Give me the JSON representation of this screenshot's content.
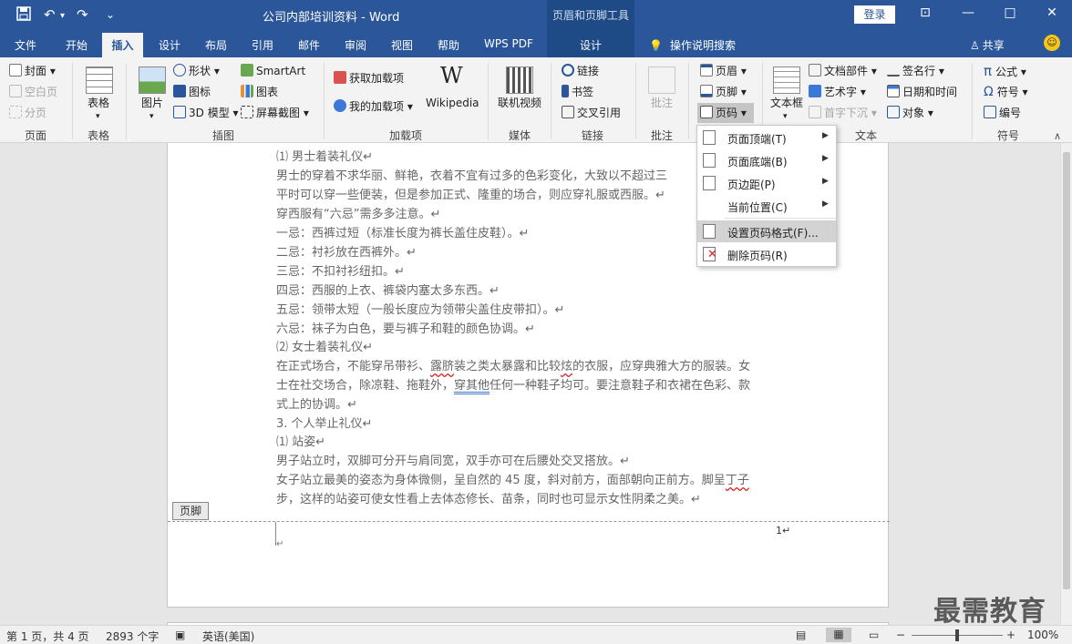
{
  "titlebar": {
    "doc_title": "公司内部培训资料 - Word",
    "context_tools": "页眉和页脚工具",
    "login": "登录",
    "save_icon": "save-icon",
    "undo": "↶",
    "redo": "↷",
    "quick_access_more": "⌄",
    "minimize": "—",
    "restore": "□",
    "close": "✕",
    "ribbon_options": "⊡"
  },
  "tabs": {
    "file": "文件",
    "home": "开始",
    "insert": "插入",
    "design": "设计",
    "layout": "布局",
    "references": "引用",
    "mailings": "邮件",
    "review": "审阅",
    "view": "视图",
    "help": "帮助",
    "wpspdf": "WPS PDF",
    "hf_design": "设计",
    "tellme": "操作说明搜索",
    "share": "共享"
  },
  "ribbon": {
    "pages": {
      "cover": "封面",
      "blank": "空白页",
      "break": "分页",
      "label": "页面"
    },
    "tables": {
      "table": "表格",
      "label": "表格"
    },
    "illustrations": {
      "picture": "图片",
      "shapes": "形状",
      "icons": "图标",
      "model3d": "3D 模型",
      "smartart": "SmartArt",
      "chart": "图表",
      "screenshot": "屏幕截图",
      "label": "插图"
    },
    "addins": {
      "get": "获取加载项",
      "mine": "我的加载项",
      "wikipedia": "Wikipedia",
      "wiki_glyph": "W",
      "label": "加载项"
    },
    "media": {
      "video": "联机视频",
      "label": "媒体"
    },
    "links": {
      "link": "链接",
      "bookmark": "书签",
      "crossref": "交叉引用",
      "label": "链接"
    },
    "comments": {
      "comment": "批注",
      "label": "批注"
    },
    "headerfooter": {
      "header": "页眉",
      "footer": "页脚",
      "pagenum": "页码"
    },
    "text": {
      "textbox": "文本框",
      "quickparts": "文档部件",
      "wordart": "艺术字",
      "dropcap": "首字下沉",
      "signature": "签名行",
      "datetime": "日期和时间",
      "object": "对象",
      "label": "文本"
    },
    "symbols": {
      "equation": "公式",
      "symbol": "符号",
      "number": "编号",
      "label": "符号",
      "pi": "π",
      "omega": "Ω"
    }
  },
  "menu": {
    "items": [
      {
        "label": "页面顶端(T)",
        "submenu": true
      },
      {
        "label": "页面底端(B)",
        "submenu": true
      },
      {
        "label": "页边距(P)",
        "submenu": true
      },
      {
        "label": "当前位置(C)",
        "submenu": true
      },
      {
        "label": "设置页码格式(F)...",
        "submenu": false,
        "highlighted": true
      },
      {
        "label": "删除页码(R)",
        "submenu": false
      }
    ],
    "arrow": "▶"
  },
  "document": {
    "lines": [
      "⑴ 男士着装礼仪↵",
      "男士的穿着不求华丽、鲜艳，衣着不宜有过多的色彩变化，大致以不超过三",
      "平时可以穿一些便装，但是参加正式、隆重的场合，则应穿礼服或西服。↵",
      "穿西服有“六忌”需多多注意。↵",
      "一忌：西裤过短（标准长度为裤长盖住皮鞋）。↵",
      "二忌：衬衫放在西裤外。↵",
      "三忌：不扣衬衫纽扣。↵",
      "四忌：西服的上衣、裤袋内塞太多东西。↵",
      "五忌：领带太短（一般长度应为领带尖盖住皮带扣）。↵",
      "六忌：袜子为白色，要与裤子和鞋的颜色协调。↵",
      "⑵ 女士着装礼仪↵"
    ],
    "para_a": {
      "p1": "在正式场合，不能穿吊带衫、",
      "p2": "露脐",
      "p3": "装之类太暴露和比较",
      "p4": "炫",
      "p5": "的衣服，应穿典雅大方的服装。女"
    },
    "para_b": {
      "p1": "士在社交场合，除凉鞋、拖鞋外，",
      "p2": "穿其他",
      "p3": "任何一种鞋子均可。要注意鞋子和衣裙在色彩、款"
    },
    "lines2": [
      "式上的协调。↵",
      "3. 个人举止礼仪↵",
      "⑴ 站姿↵",
      "男子站立时，双脚可分开与肩同宽，双手亦可在后腰处交叉搭放。↵"
    ],
    "para_c": {
      "p1": "女子站立最美的姿态为身体微侧，呈自然的 45 度，斜对前方，面部朝向正前方。脚呈",
      "p2": "丁子"
    },
    "last_line": "步，这样的站姿可使女性看上去体态修长、苗条，同时也可显示女性阴柔之美。↵",
    "footer_tag": "页脚",
    "page_number": "1↵",
    "footer_mark": "↵"
  },
  "status": {
    "page": "第 1 页，共 4 页",
    "words": "2893 个字",
    "language": "英语(美国)",
    "zoom_minus": "−",
    "zoom_plus": "+",
    "zoom": "100%"
  },
  "watermark": "最需教育",
  "colors": {
    "accent": "#2b579a",
    "context": "#1e4a86"
  }
}
